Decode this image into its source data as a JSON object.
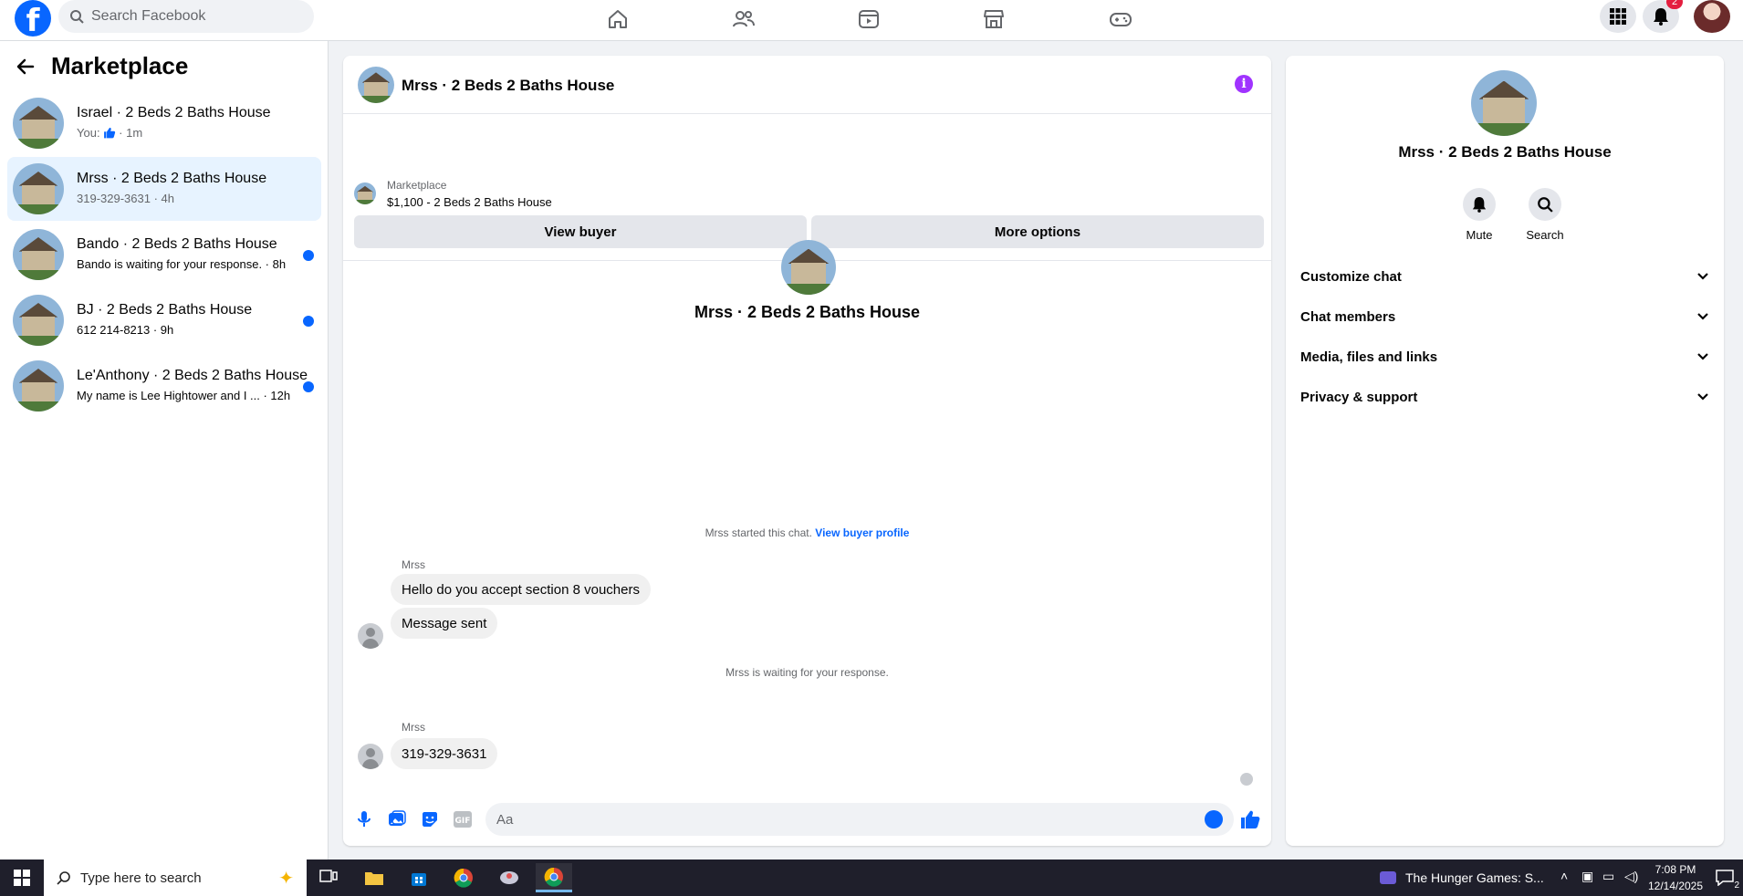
{
  "topbar": {
    "logo": "f",
    "search_placeholder": "Search Facebook",
    "nav_icons": [
      "home-icon",
      "friends-icon",
      "video-icon",
      "marketplace-icon",
      "gaming-icon"
    ],
    "notification_count": "2"
  },
  "sidebar": {
    "title": "Marketplace",
    "conversations": [
      {
        "name": "Israel · 2 Beds 2 Baths House",
        "sub_prefix": "You: ",
        "sub": "· 1m",
        "unread": false,
        "active": false
      },
      {
        "name": "Mrss · 2 Beds 2 Baths House",
        "sub": "319-329-3631 · 4h",
        "unread": false,
        "active": true
      },
      {
        "name": "Bando · 2 Beds 2 Baths House",
        "sub": "Bando is waiting for your response. · 8h",
        "unread": true,
        "active": false
      },
      {
        "name": "BJ · 2 Beds 2 Baths House",
        "sub": "612 214-8213 · 9h",
        "unread": true,
        "active": false
      },
      {
        "name": "Le'Anthony · 2 Beds 2 Baths House",
        "sub": "My name is Lee Hightower and I ... · 12h",
        "unread": true,
        "active": false
      }
    ]
  },
  "chat": {
    "title": "Mrss · 2 Beds 2 Baths House",
    "listing_source": "Marketplace",
    "listing_price": "$1,100 - 2 Beds 2 Baths House",
    "view_buyer": "View buyer",
    "more_options": "More options",
    "center_title": "Mrss · 2 Beds 2 Baths House",
    "started": "Mrss started this chat.",
    "view_profile": "View buyer profile",
    "messages_1_sender": "Mrss",
    "messages_1": [
      "Hello do you accept section 8 vouchers",
      "Message sent"
    ],
    "waiting": "Mrss is waiting for your response.",
    "messages_2_sender": "Mrss",
    "messages_2": [
      "319-329-3631"
    ],
    "composer_placeholder": "Aa"
  },
  "details": {
    "title": "Mrss · 2 Beds 2 Baths House",
    "mute": "Mute",
    "search": "Search",
    "sections": [
      "Customize chat",
      "Chat members",
      "Media, files and links",
      "Privacy & support"
    ]
  },
  "taskbar": {
    "search_placeholder": "Type here to search",
    "media_title": "The Hunger Games: S...",
    "time": "7:08 PM",
    "date": "12/14/2025",
    "notif": "2"
  },
  "colors": {
    "accent": "#0866ff",
    "active_bg": "#e7f3ff",
    "info": "#a033ff"
  }
}
